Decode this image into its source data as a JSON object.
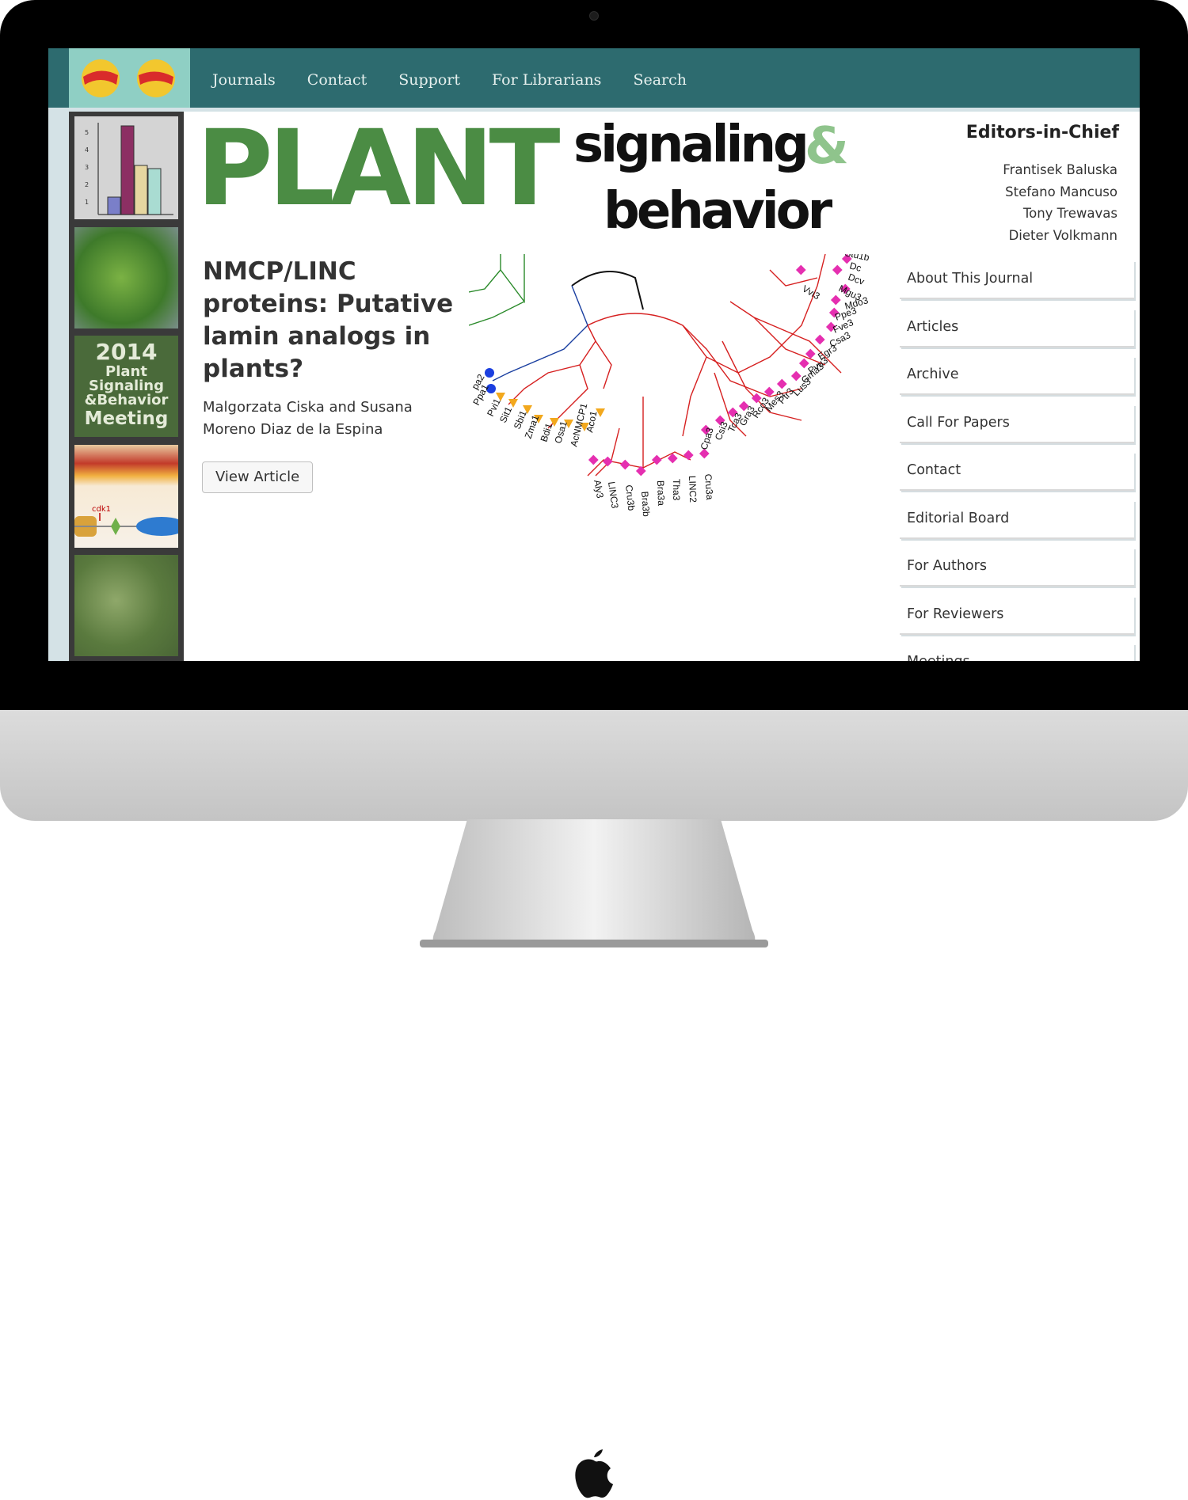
{
  "nav": {
    "links": [
      "Journals",
      "Contact",
      "Support",
      "For Librarians",
      "Search"
    ]
  },
  "sidebar_thumbs": {
    "meeting_year": "2014",
    "meeting_line1": "Plant",
    "meeting_line2": "Signaling",
    "meeting_line3": "&Behavior",
    "meeting_line4": "Meeting",
    "bar_ticks": [
      "5",
      "4",
      "3",
      "2",
      "1"
    ],
    "gene_label": "cdk1"
  },
  "masthead": {
    "word1": "PLANT",
    "word2": "signaling",
    "amp": "&",
    "word3": "behavior"
  },
  "feature": {
    "title": "NMCP/LINC proteins: Putative lamin analogs in plants?",
    "authors": "Malgorzata Ciska and Susana Moreno Diaz de la Espina",
    "button": "View Article"
  },
  "tree_labels": [
    "pa2",
    "Ppa1",
    "Pvi1",
    "Sit1",
    "Sbi1",
    "Zma1",
    "Bdi1",
    "Osa1",
    "AcNMCP1",
    "Aco1",
    "Aly3",
    "LINC3",
    "Cru3b",
    "Bra3b",
    "Bra3a",
    "Tha3",
    "LINC2",
    "Cru3a",
    "Cpa3",
    "Csi3",
    "Tca3",
    "Gra3",
    "Rco3",
    "Mes3",
    "Ptr3",
    "Lus3",
    "Gma3",
    "Pvu3",
    "Egr3",
    "Csa3",
    "Fve3",
    "Ppe3",
    "Mdo3",
    "Vvi3",
    "Mgu3",
    "Dcv",
    "Dc",
    "Stu1b"
  ],
  "editors": {
    "heading": "Editors-in-Chief",
    "names": [
      "Frantisek Baluska",
      "Stefano Mancuso",
      "Tony Trewavas",
      "Dieter Volkmann"
    ]
  },
  "menu": [
    "About This Journal",
    "Articles",
    "Archive",
    "Call For Papers",
    "Contact",
    "Editorial Board",
    "For Authors",
    "For Reviewers",
    "Meetings"
  ]
}
